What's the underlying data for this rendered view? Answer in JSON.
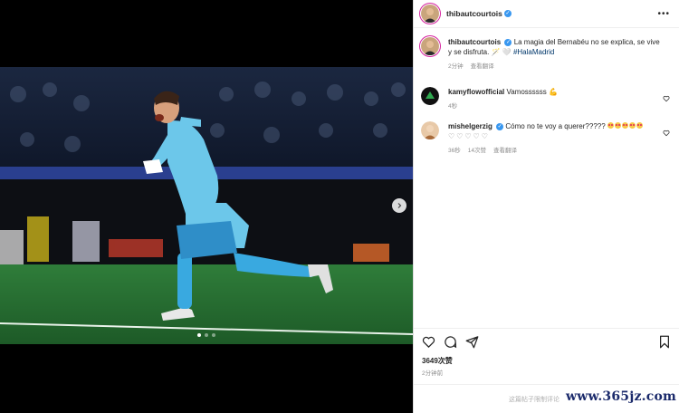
{
  "post": {
    "username": "thibautcourtois",
    "more_icon": "more-icon",
    "image_alt_icon": "photo",
    "carousel": {
      "slides": 3,
      "active": 1
    }
  },
  "caption": {
    "username": "thibautcourtois",
    "text": "La magia del Bernabéu no se explica, se vive y se disfruta. 🪄 🤍",
    "hashtag": "#HalaMadrid",
    "time": "2分钟",
    "translate": "查看翻译"
  },
  "comments": [
    {
      "username": "kamyflowofficial",
      "text": "Vamossssss 💪",
      "time": "4秒"
    },
    {
      "username": "mishelgerzig",
      "text": "Cómo no te voy a querer?????",
      "hearts_row": "♡♡♡♡♡",
      "time": "36秒",
      "likes": "14次赞",
      "translate": "查看翻译"
    }
  ],
  "stats": {
    "likes": "3649次赞",
    "posted": "2分钟前"
  },
  "footer": {
    "notice": "这篇帖子限制评论"
  },
  "watermark": "www.365jz.com",
  "colors": {
    "accent": "#3897f0",
    "pitch": "#2f7d3a",
    "kit": "#39a9e0"
  }
}
